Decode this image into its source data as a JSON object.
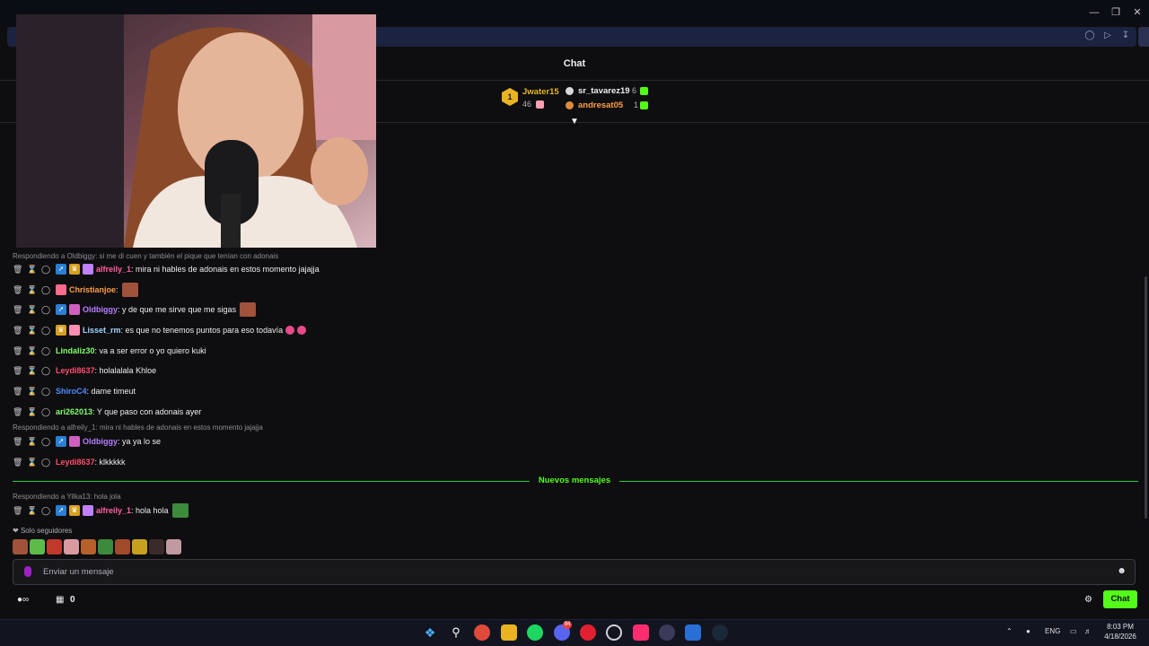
{
  "window": {
    "minimize_icon": "minimize-icon",
    "restore_icon": "restore-icon",
    "close_icon": "close-icon"
  },
  "chat": {
    "title": "Chat"
  },
  "leaderboard": {
    "first": {
      "rank": "1",
      "name": "Jwater15",
      "count": "46"
    },
    "second": {
      "name": "sr_tavarez19",
      "count": "6"
    },
    "third": {
      "name": "andresat05",
      "count": "1"
    }
  },
  "messages": [
    {
      "reply": "Respondiendo a Oldbiggy: si me di cuen y también el pique que tenían con adonais"
    },
    {
      "user": "alfreily_1",
      "color": "#ff5fa2",
      "text": ": mira ni hables de adonais en estos momento jajajja"
    },
    {
      "user": "Christianjoe",
      "color": "#ff9f43",
      "text": ":"
    },
    {
      "user": "Oldbiggy",
      "color": "#b77dff",
      "text": ": y de que me sirve que me sigas"
    },
    {
      "user": "Lisset_rm",
      "color": "#9fd3ff",
      "text": ": es que no tenemos puntos para eso todavía"
    },
    {
      "user": "Lindaliz30",
      "color": "#7fff6a",
      "text": ": va a ser error o yo quiero kuki"
    },
    {
      "user": "Leydi8637",
      "color": "#ff4d6d",
      "text": ": holalalala Khloe"
    },
    {
      "user": "ShiroC4",
      "color": "#4d8bff",
      "text": ": dame timeut"
    },
    {
      "user": "ari262013",
      "color": "#7fff6a",
      "text": ": Y que paso con adonais ayer"
    },
    {
      "reply": "Respondiendo a alfreily_1: mira ni hables de adonais en estos momento jajajja"
    },
    {
      "user": "Oldbiggy",
      "color": "#b77dff",
      "text": ": ya ya lo se"
    },
    {
      "user": "Leydi8637",
      "color": "#ff4d6d",
      "text": ": klkkkkk"
    },
    {
      "reply": "Respondiendo a Yilka13: hola jola"
    },
    {
      "user": "alfreily_1",
      "color": "#ff5fa2",
      "text": ": hola hola"
    }
  ],
  "new_messages_label": "Nuevos mensajes",
  "followers_only": "Solo seguidores",
  "input": {
    "placeholder": "Enviar un mensaje"
  },
  "bottom": {
    "points_count": "0",
    "chat_button": "Chat"
  },
  "taskbar": {
    "lang": "ENG",
    "time": "8:03 PM",
    "date": "4/18/2026",
    "discord_badge": "94"
  },
  "colors": {
    "accent": "#53fc18",
    "background": "#0e0e10"
  }
}
